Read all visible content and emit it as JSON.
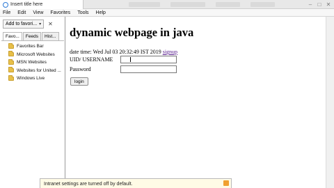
{
  "window": {
    "tab_title": "Insert title here"
  },
  "menubar": {
    "items": [
      "File",
      "Edit",
      "View",
      "Favorites",
      "Tools",
      "Help"
    ]
  },
  "favorites_pane": {
    "add_button_label": "Add to favori...",
    "tabs": [
      "Favo...",
      "Feeds",
      "Hist..."
    ],
    "items": [
      {
        "label": "Favorites Bar",
        "icon": "folder-icon"
      },
      {
        "label": "Microsoft Websites",
        "icon": "folder-icon"
      },
      {
        "label": "MSN Websites",
        "icon": "folder-icon"
      },
      {
        "label": "Websites for United ...",
        "icon": "folder-icon"
      },
      {
        "label": "Windows Live",
        "icon": "folder-icon"
      }
    ]
  },
  "page": {
    "heading": "dynamic webpage in java",
    "date_prefix": "date time: Wed Jul 03 20:32:49 IST 2019",
    "signup_link": "signup",
    "uid_label": "UID/ USERNAME",
    "uid_value": "",
    "password_label": "Password",
    "password_value": "",
    "login_button": "login"
  },
  "notification": {
    "text": "Intranet settings are turned off by default."
  }
}
